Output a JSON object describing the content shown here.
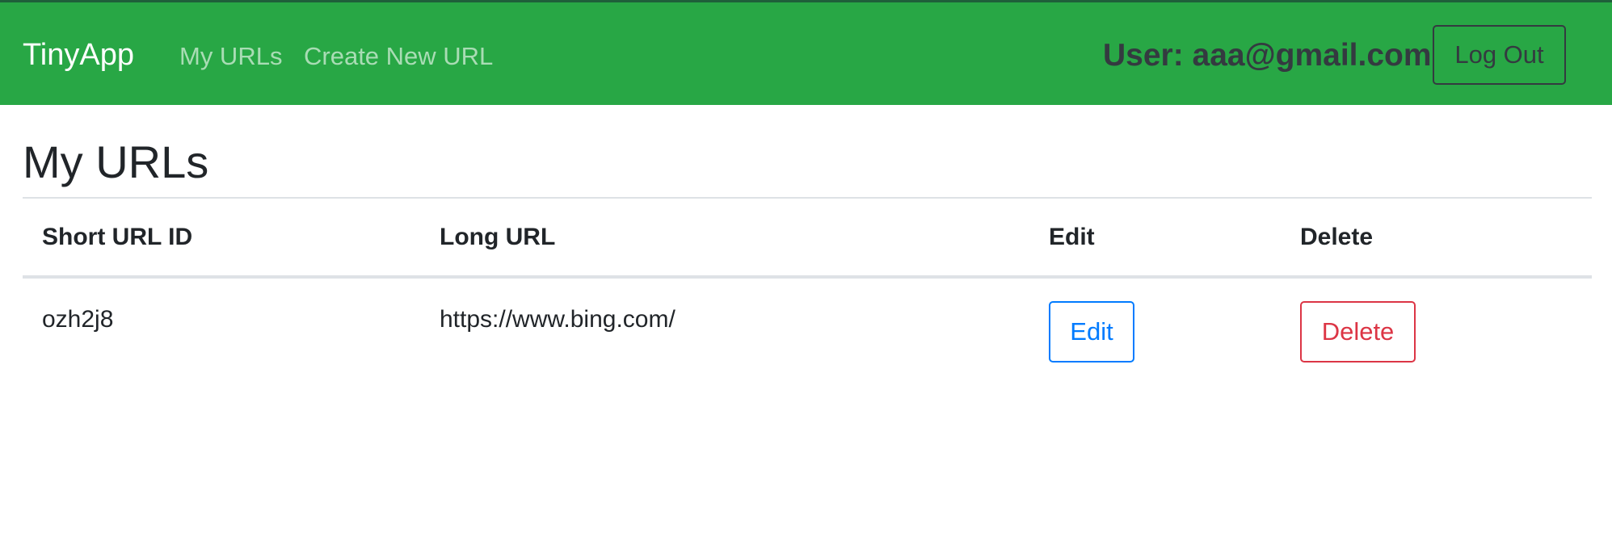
{
  "navbar": {
    "brand": "TinyApp",
    "links": [
      {
        "label": "My URLs"
      },
      {
        "label": "Create New URL"
      }
    ],
    "user_label": "User: aaa@gmail.com",
    "logout_label": "Log Out",
    "background_color": "#28a745"
  },
  "main": {
    "title": "My URLs",
    "table": {
      "headers": [
        "Short URL ID",
        "Long URL",
        "Edit",
        "Delete"
      ],
      "rows": [
        {
          "short_id": "ozh2j8",
          "long_url": "https://www.bing.com/",
          "edit_label": "Edit",
          "delete_label": "Delete"
        }
      ]
    }
  },
  "colors": {
    "edit_button": "#007bff",
    "delete_button": "#dc3545"
  }
}
